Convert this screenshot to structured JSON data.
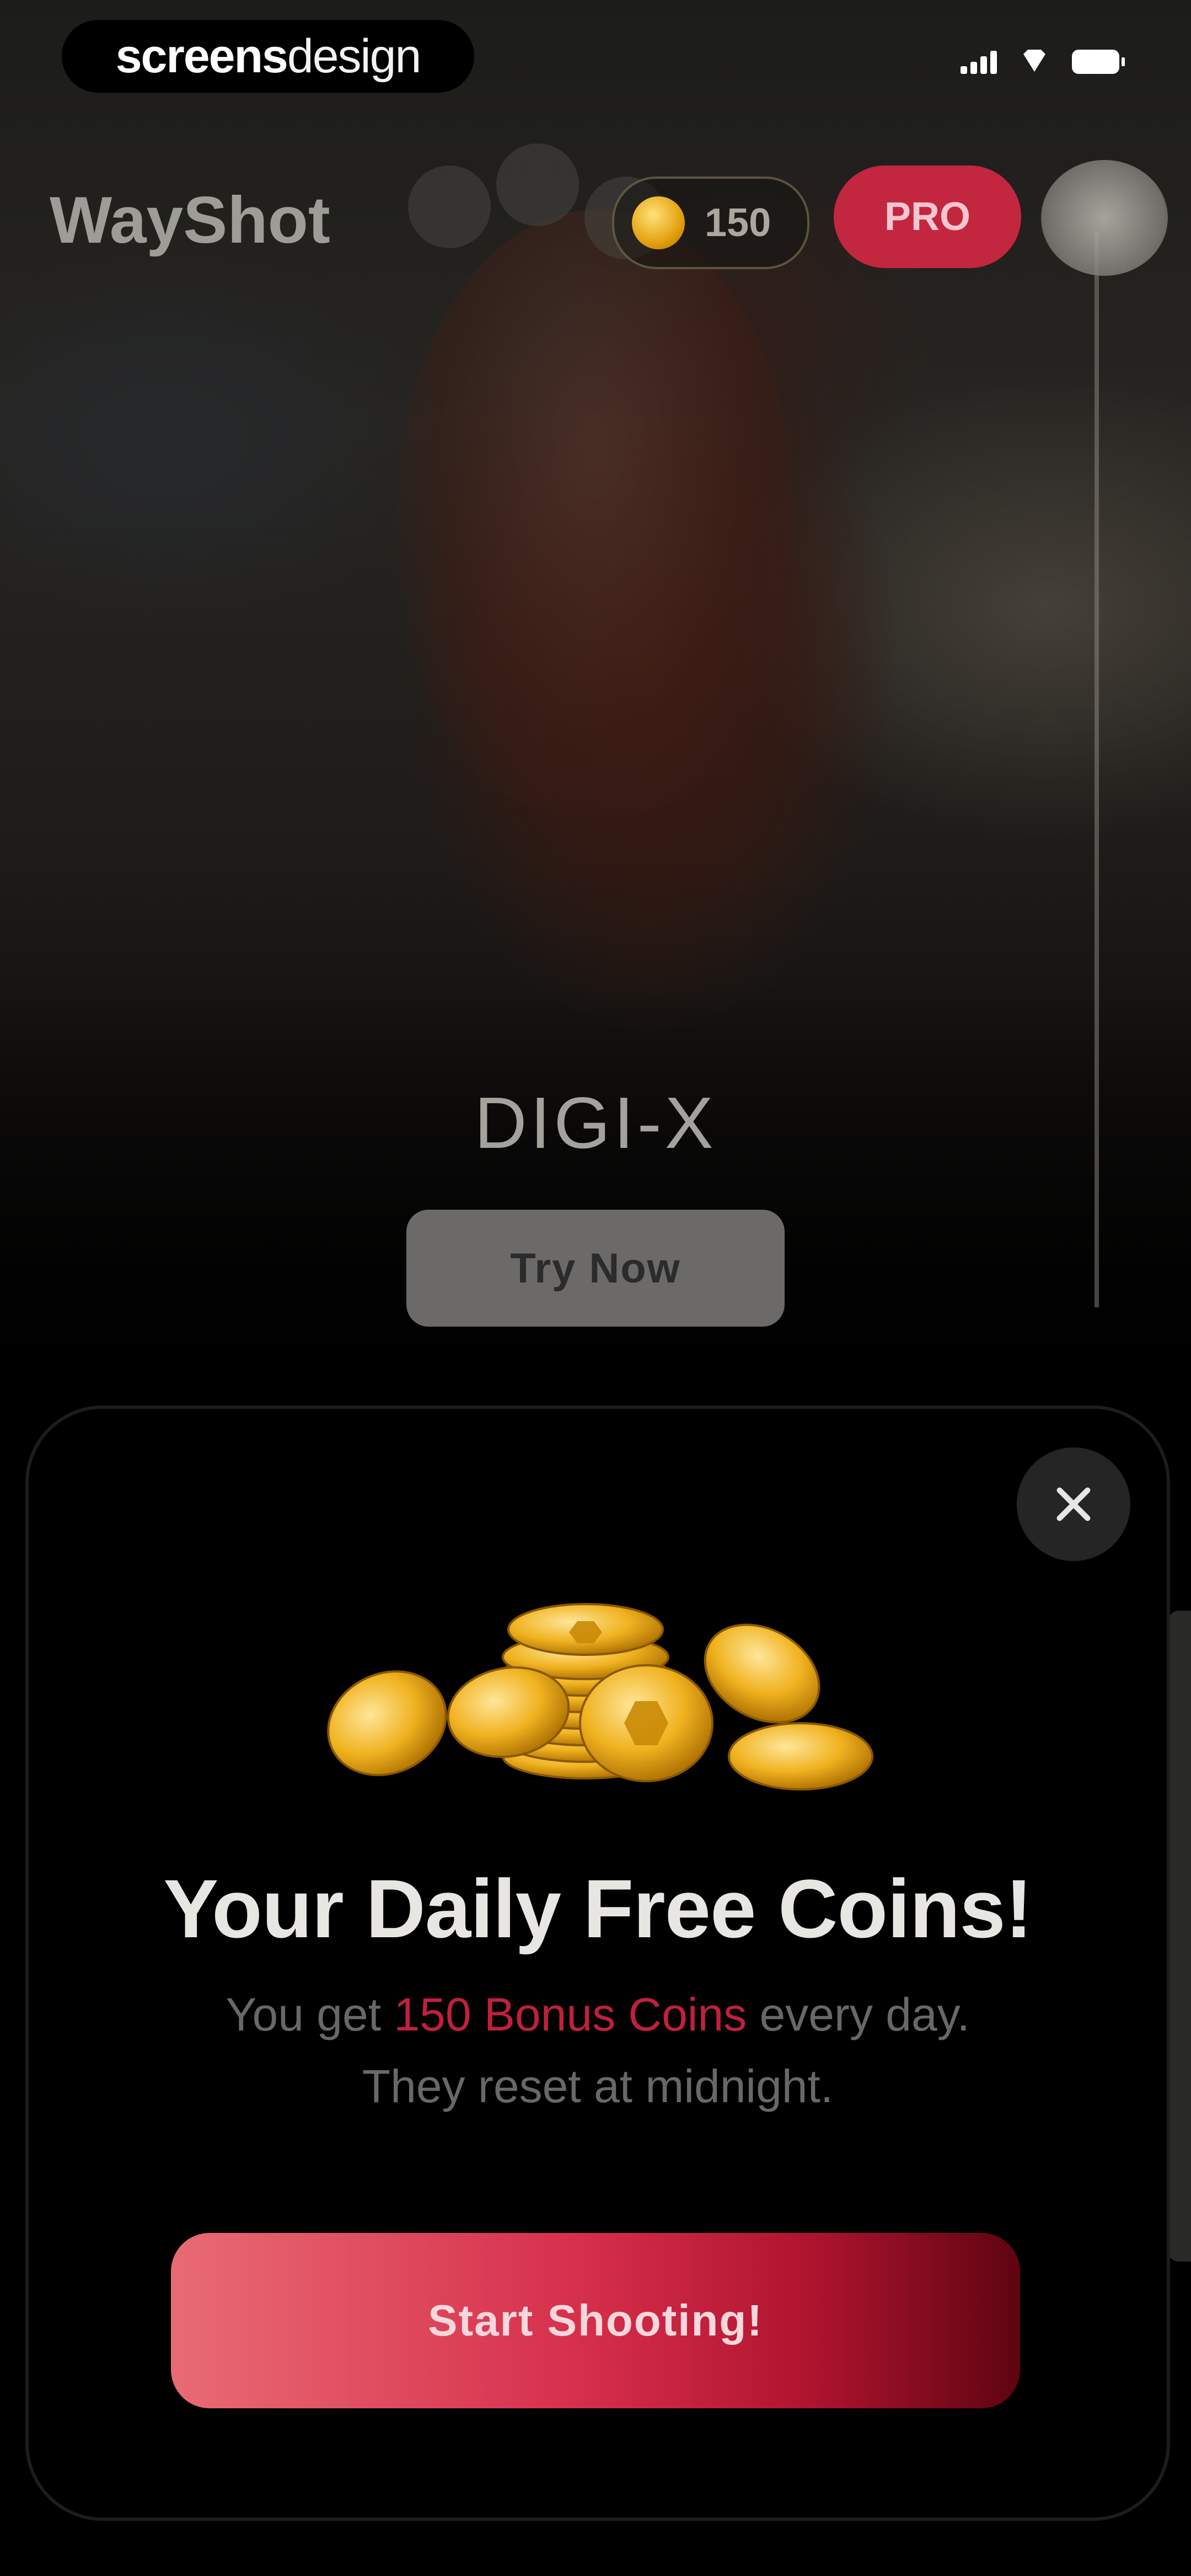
{
  "status_bar": {
    "brand_strong": "screens",
    "brand_light": "design"
  },
  "header": {
    "app_title": "WayShot",
    "coin_count": "150",
    "pro_label": "PRO"
  },
  "feature": {
    "name": "DIGI-X",
    "try_label": "Try Now"
  },
  "modal": {
    "title": "Your Daily Free Coins!",
    "subtitle_prefix": "You get ",
    "subtitle_highlight": "150 Bonus Coins",
    "subtitle_suffix": " every day.",
    "subtitle_line2": "They reset at midnight.",
    "cta_label": "Start Shooting!"
  },
  "colors": {
    "accent": "#c3263f",
    "highlight": "#c0203d",
    "modal_bg": "#000000"
  },
  "icons": {
    "close": "close-icon",
    "coin": "coin-icon",
    "signal": "signal-icon",
    "wifi": "wifi-icon",
    "battery": "battery-icon"
  }
}
